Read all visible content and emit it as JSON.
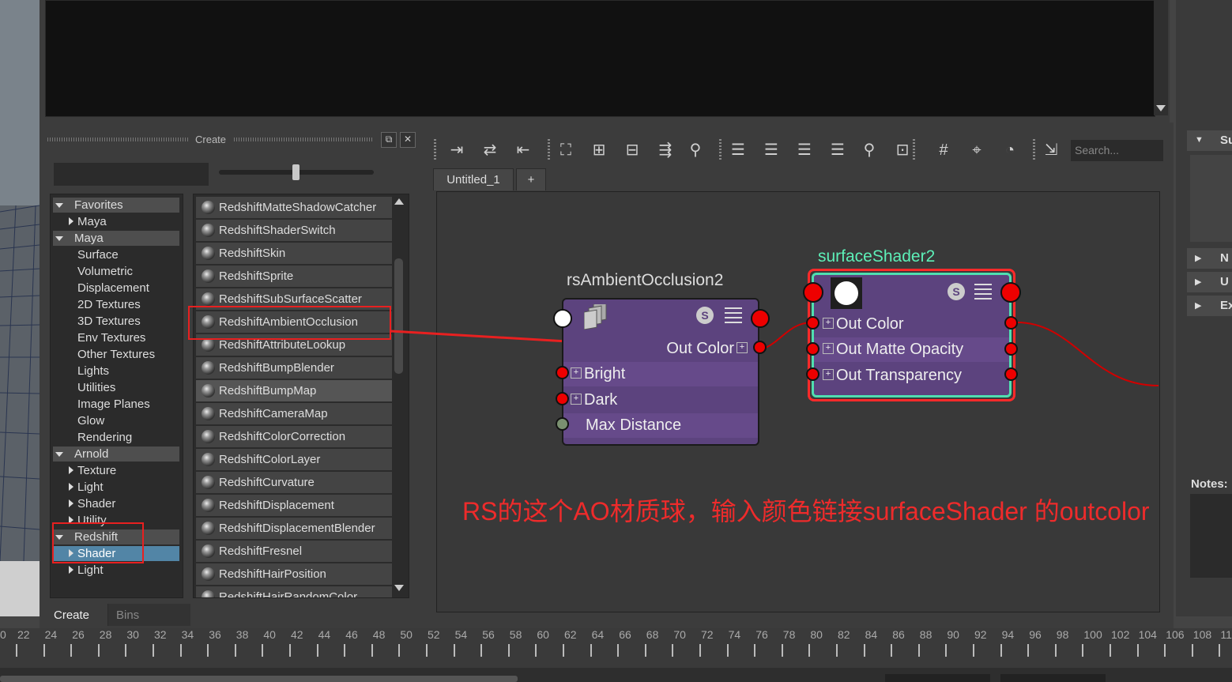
{
  "create_panel": {
    "title": "Create",
    "tree": [
      {
        "label": "Favorites",
        "kind": "header",
        "expanded": true
      },
      {
        "label": "Maya",
        "kind": "collapsed"
      },
      {
        "label": "Maya",
        "kind": "header",
        "expanded": true
      },
      {
        "label": "Surface",
        "kind": "leaf"
      },
      {
        "label": "Volumetric",
        "kind": "leaf"
      },
      {
        "label": "Displacement",
        "kind": "leaf"
      },
      {
        "label": "2D Textures",
        "kind": "leaf"
      },
      {
        "label": "3D Textures",
        "kind": "leaf"
      },
      {
        "label": "Env Textures",
        "kind": "leaf"
      },
      {
        "label": "Other Textures",
        "kind": "leaf"
      },
      {
        "label": "Lights",
        "kind": "leaf"
      },
      {
        "label": "Utilities",
        "kind": "leaf"
      },
      {
        "label": "Image Planes",
        "kind": "leaf"
      },
      {
        "label": "Glow",
        "kind": "leaf"
      },
      {
        "label": "Rendering",
        "kind": "leaf"
      },
      {
        "label": "Arnold",
        "kind": "header",
        "expanded": true
      },
      {
        "label": "Texture",
        "kind": "collapsed"
      },
      {
        "label": "Light",
        "kind": "collapsed"
      },
      {
        "label": "Shader",
        "kind": "collapsed"
      },
      {
        "label": "Utility",
        "kind": "collapsed"
      },
      {
        "label": "Redshift",
        "kind": "header",
        "expanded": true
      },
      {
        "label": "Shader",
        "kind": "collapsed",
        "selected": true
      },
      {
        "label": "Light",
        "kind": "collapsed"
      }
    ],
    "shader_list": [
      "RedshiftMatteShadowCatcher",
      "RedshiftShaderSwitch",
      "RedshiftSkin",
      "RedshiftSprite",
      "RedshiftSubSurfaceScatter",
      "RedshiftAmbientOcclusion",
      "RedshiftAttributeLookup",
      "RedshiftBumpBlender",
      "RedshiftBumpMap",
      "RedshiftCameraMap",
      "RedshiftColorCorrection",
      "RedshiftColorLayer",
      "RedshiftCurvature",
      "RedshiftDisplacement",
      "RedshiftDisplacementBlender",
      "RedshiftFresnel",
      "RedshiftHairPosition",
      "RedshiftHairRandomColor"
    ],
    "highlighted_item": "RedshiftBumpMap",
    "tabs": [
      "Create",
      "Bins"
    ],
    "active_tab": "Create"
  },
  "node_editor": {
    "search_placeholder": "Search...",
    "tabs": [
      "Untitled_1",
      "+"
    ],
    "active_tab": "Untitled_1",
    "nodes": [
      {
        "name": "rsAmbientOcclusion2",
        "output": "Out Color",
        "inputs": [
          "Bright",
          "Dark",
          "Max Distance"
        ]
      },
      {
        "name": "surfaceShader2",
        "attributes": [
          "Out Color",
          "Out Matte Opacity",
          "Out Transparency"
        ],
        "selected": true
      }
    ],
    "toolbar_icons": [
      "input-connections-icon",
      "input-output-icon",
      "output-connections-icon",
      "frame-all-icon",
      "add-selected-icon",
      "remove-selected-icon",
      "layout-icon",
      "pin-icon",
      "simple-view-icon",
      "connected-view-icon",
      "full-view-icon",
      "custom-view-icon",
      "search-icon",
      "grid-snap-icon",
      "grid-icon",
      "bookmark-icon",
      "camera-icon",
      "graph-icon"
    ]
  },
  "right_panel": {
    "headers": [
      {
        "label": "Su",
        "expanded": true
      },
      {
        "label": "N",
        "expanded": false
      },
      {
        "label": "U",
        "expanded": false
      },
      {
        "label": "Ex",
        "expanded": false
      }
    ],
    "notes_label": "Notes:"
  },
  "timeline": {
    "labels": [
      "0",
      "22",
      "24",
      "26",
      "28",
      "30",
      "32",
      "34",
      "36",
      "38",
      "40",
      "42",
      "44",
      "46",
      "48",
      "50",
      "52",
      "54",
      "56",
      "58",
      "60",
      "62",
      "64",
      "66",
      "68",
      "70",
      "72",
      "74",
      "76",
      "78",
      "80",
      "82",
      "84",
      "86",
      "88",
      "90",
      "92",
      "94",
      "96",
      "98",
      "100",
      "102",
      "104",
      "106",
      "108",
      "11"
    ]
  },
  "annotation": {
    "text": "RS的这个AO材质球，输入颜色链接surfaceShader 的outcolor",
    "color": "#ee2b2b"
  },
  "colors": {
    "node_body": "#5c437e",
    "port_red": "#e00000",
    "selection_green": "#4fdfb0",
    "selection_red": "#ff2a2a",
    "tree_selected": "#5285a6",
    "surface_title": "#5df0b8"
  }
}
